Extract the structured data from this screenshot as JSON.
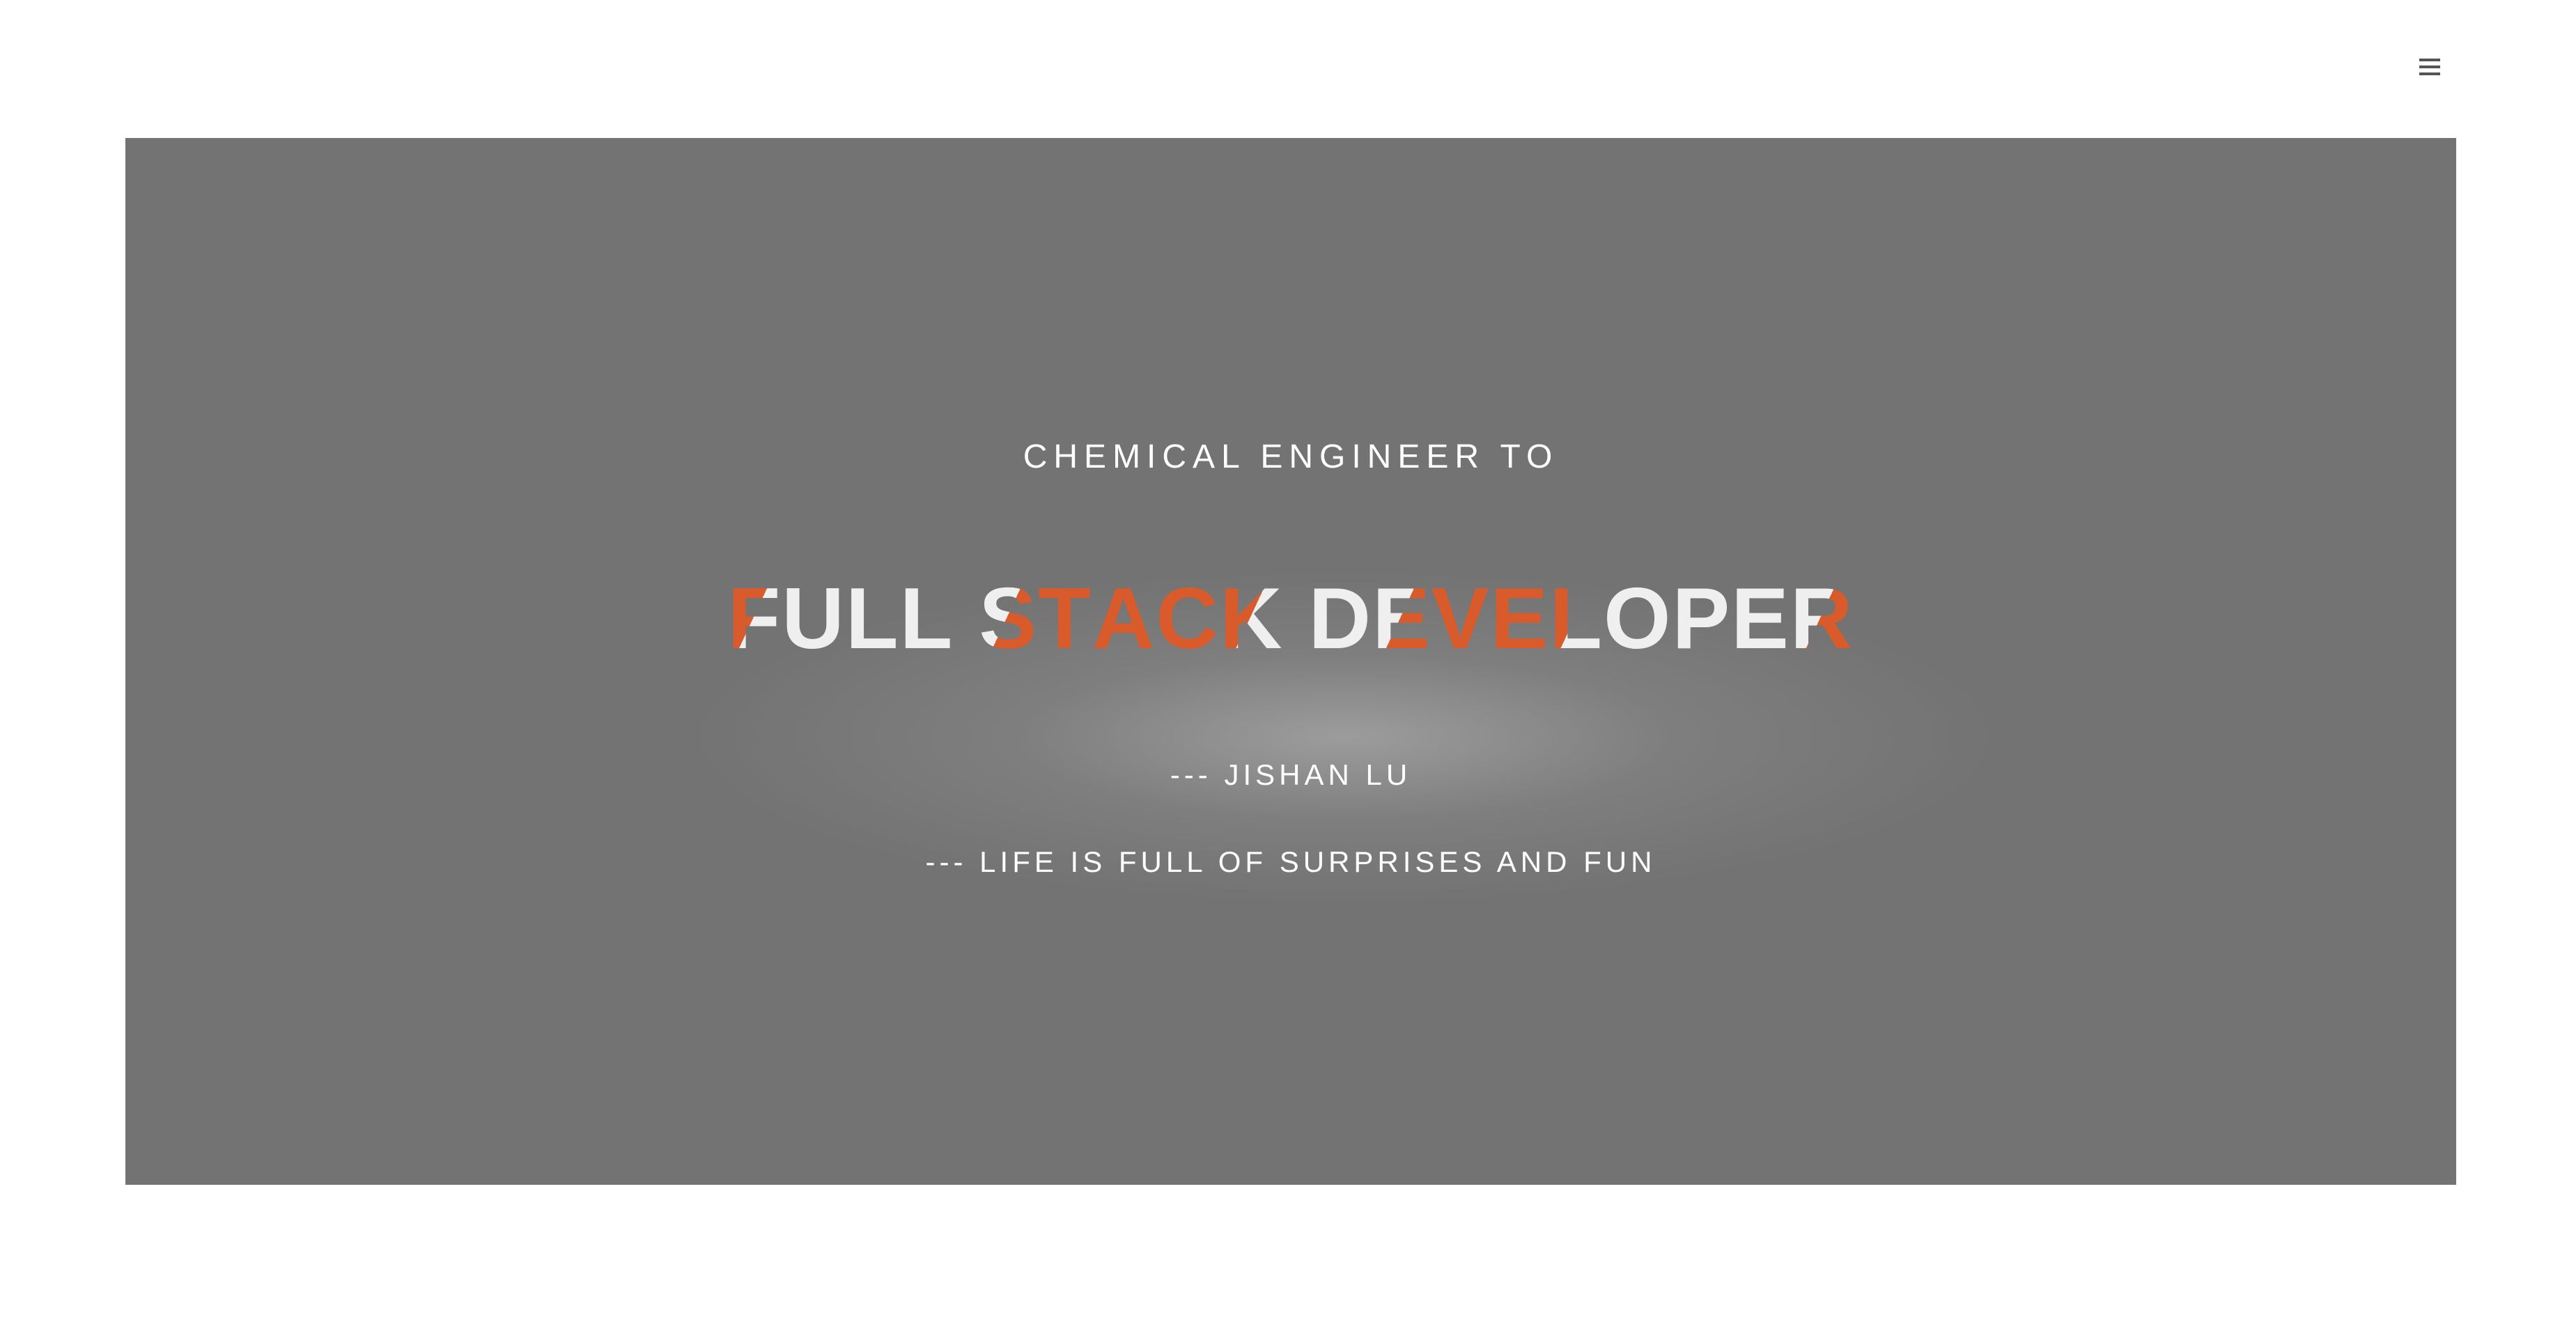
{
  "header": {
    "menu_icon": "hamburger-menu-icon",
    "menu_icon_glyph": "≡"
  },
  "hero": {
    "background_color": "#737373",
    "accent_color": "#d95a2a",
    "subtitle": "CHEMICAL ENGINEER TO",
    "headline": "FULL STACK DEVELOPER",
    "byline": "--- JISHAN LU",
    "motto": "--- LIFE IS FULL OF SURPRISES AND FUN"
  }
}
